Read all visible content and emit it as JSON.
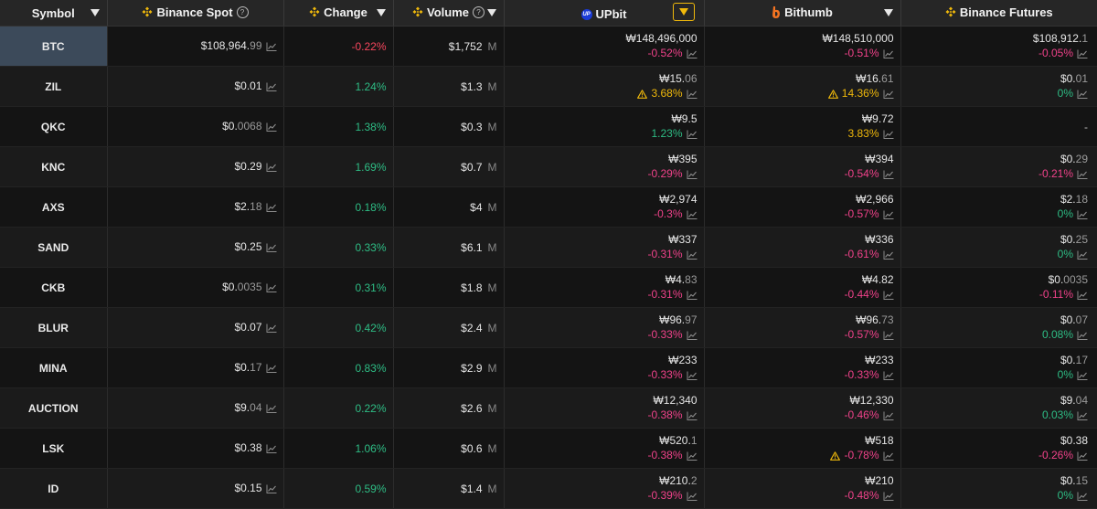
{
  "header": {
    "symbol": "Symbol",
    "binance_spot": "Binance Spot",
    "change": "Change",
    "volume": "Volume",
    "upbit": "UPbit",
    "bithumb": "Bithumb",
    "binance_futures": "Binance Futures",
    "upbit_icon_text": "UP"
  },
  "colors": {
    "negative": "#f6465d",
    "positive": "#2ebd85",
    "warning": "#f0b90b",
    "active_row": "#3c4a5a"
  },
  "rows": [
    {
      "symbol": "BTC",
      "spot": "$108,964.",
      "spot_dim": "99",
      "change": "-0.22%",
      "change_sign": "neg",
      "volume": "$1,752",
      "up_price": "₩148,496,000",
      "up_dim": "",
      "up_pct": "-0.52%",
      "up_sign": "negp",
      "up_warn": false,
      "bit_price": "₩148,510,000",
      "bit_dim": "",
      "bit_pct": "-0.51%",
      "bit_sign": "negp",
      "bit_warn": false,
      "fut_price": "$108,912.",
      "fut_dim": "1",
      "fut_pct": "-0.05%",
      "fut_sign": "negp"
    },
    {
      "symbol": "ZIL",
      "spot": "$0.01",
      "spot_dim": "",
      "change": "1.24%",
      "change_sign": "pos",
      "volume": "$1.3",
      "up_price": "₩15.",
      "up_dim": "06",
      "up_pct": "3.68%",
      "up_sign": "warn",
      "up_warn": true,
      "bit_price": "₩16.",
      "bit_dim": "61",
      "bit_pct": "14.36%",
      "bit_sign": "warn",
      "bit_warn": true,
      "fut_price": "$0.",
      "fut_dim": "01",
      "fut_pct": "0%",
      "fut_sign": "pos"
    },
    {
      "symbol": "QKC",
      "spot": "$0.",
      "spot_dim": "0068",
      "change": "1.38%",
      "change_sign": "pos",
      "volume": "$0.3",
      "up_price": "₩9.5",
      "up_dim": "",
      "up_pct": "1.23%",
      "up_sign": "pos",
      "up_warn": false,
      "bit_price": "₩9.72",
      "bit_dim": "",
      "bit_pct": "3.83%",
      "bit_sign": "warn",
      "bit_warn": false,
      "fut_price": "",
      "fut_dim": "",
      "fut_pct": "",
      "fut_sign": "pos",
      "fut_dash": "-"
    },
    {
      "symbol": "KNC",
      "spot": "$0.29",
      "spot_dim": "",
      "change": "1.69%",
      "change_sign": "pos",
      "volume": "$0.7",
      "up_price": "₩395",
      "up_dim": "",
      "up_pct": "-0.29%",
      "up_sign": "negp",
      "up_warn": false,
      "bit_price": "₩394",
      "bit_dim": "",
      "bit_pct": "-0.54%",
      "bit_sign": "negp",
      "bit_warn": false,
      "fut_price": "$0.",
      "fut_dim": "29",
      "fut_pct": "-0.21%",
      "fut_sign": "negp"
    },
    {
      "symbol": "AXS",
      "spot": "$2.",
      "spot_dim": "18",
      "change": "0.18%",
      "change_sign": "pos",
      "volume": "$4",
      "up_price": "₩2,974",
      "up_dim": "",
      "up_pct": "-0.3%",
      "up_sign": "negp",
      "up_warn": false,
      "bit_price": "₩2,966",
      "bit_dim": "",
      "bit_pct": "-0.57%",
      "bit_sign": "negp",
      "bit_warn": false,
      "fut_price": "$2.",
      "fut_dim": "18",
      "fut_pct": "0%",
      "fut_sign": "pos"
    },
    {
      "symbol": "SAND",
      "spot": "$0.25",
      "spot_dim": "",
      "change": "0.33%",
      "change_sign": "pos",
      "volume": "$6.1",
      "up_price": "₩337",
      "up_dim": "",
      "up_pct": "-0.31%",
      "up_sign": "negp",
      "up_warn": false,
      "bit_price": "₩336",
      "bit_dim": "",
      "bit_pct": "-0.61%",
      "bit_sign": "negp",
      "bit_warn": false,
      "fut_price": "$0.",
      "fut_dim": "25",
      "fut_pct": "0%",
      "fut_sign": "pos"
    },
    {
      "symbol": "CKB",
      "spot": "$0.",
      "spot_dim": "0035",
      "change": "0.31%",
      "change_sign": "pos",
      "volume": "$1.8",
      "up_price": "₩4.",
      "up_dim": "83",
      "up_pct": "-0.31%",
      "up_sign": "negp",
      "up_warn": false,
      "bit_price": "₩4.82",
      "bit_dim": "",
      "bit_pct": "-0.44%",
      "bit_sign": "negp",
      "bit_warn": false,
      "fut_price": "$0.",
      "fut_dim": "0035",
      "fut_pct": "-0.11%",
      "fut_sign": "negp"
    },
    {
      "symbol": "BLUR",
      "spot": "$0.07",
      "spot_dim": "",
      "change": "0.42%",
      "change_sign": "pos",
      "volume": "$2.4",
      "up_price": "₩96.",
      "up_dim": "97",
      "up_pct": "-0.33%",
      "up_sign": "negp",
      "up_warn": false,
      "bit_price": "₩96.",
      "bit_dim": "73",
      "bit_pct": "-0.57%",
      "bit_sign": "negp",
      "bit_warn": false,
      "fut_price": "$0.",
      "fut_dim": "07",
      "fut_pct": "0.08%",
      "fut_sign": "pos"
    },
    {
      "symbol": "MINA",
      "spot": "$0.",
      "spot_dim": "17",
      "change": "0.83%",
      "change_sign": "pos",
      "volume": "$2.9",
      "up_price": "₩233",
      "up_dim": "",
      "up_pct": "-0.33%",
      "up_sign": "negp",
      "up_warn": false,
      "bit_price": "₩233",
      "bit_dim": "",
      "bit_pct": "-0.33%",
      "bit_sign": "negp",
      "bit_warn": false,
      "fut_price": "$0.",
      "fut_dim": "17",
      "fut_pct": "0%",
      "fut_sign": "pos"
    },
    {
      "symbol": "AUCTION",
      "spot": "$9.",
      "spot_dim": "04",
      "change": "0.22%",
      "change_sign": "pos",
      "volume": "$2.6",
      "up_price": "₩12,340",
      "up_dim": "",
      "up_pct": "-0.38%",
      "up_sign": "negp",
      "up_warn": false,
      "bit_price": "₩12,330",
      "bit_dim": "",
      "bit_pct": "-0.46%",
      "bit_sign": "negp",
      "bit_warn": false,
      "fut_price": "$9.",
      "fut_dim": "04",
      "fut_pct": "0.03%",
      "fut_sign": "pos"
    },
    {
      "symbol": "LSK",
      "spot": "$0.38",
      "spot_dim": "",
      "change": "1.06%",
      "change_sign": "pos",
      "volume": "$0.6",
      "up_price": "₩520.",
      "up_dim": "1",
      "up_pct": "-0.38%",
      "up_sign": "negp",
      "up_warn": false,
      "bit_price": "₩518",
      "bit_dim": "",
      "bit_pct": "-0.78%",
      "bit_sign": "negp",
      "bit_warn": true,
      "fut_price": "$0.38",
      "fut_dim": "",
      "fut_pct": "-0.26%",
      "fut_sign": "negp"
    },
    {
      "symbol": "ID",
      "spot": "$0.15",
      "spot_dim": "",
      "change": "0.59%",
      "change_sign": "pos",
      "volume": "$1.4",
      "up_price": "₩210.",
      "up_dim": "2",
      "up_pct": "-0.39%",
      "up_sign": "negp",
      "up_warn": false,
      "bit_price": "₩210",
      "bit_dim": "",
      "bit_pct": "-0.48%",
      "bit_sign": "negp",
      "bit_warn": false,
      "fut_price": "$0.",
      "fut_dim": "15",
      "fut_pct": "0%",
      "fut_sign": "pos"
    }
  ],
  "volume_unit": "M",
  "icons": {
    "chart": "chart-line-icon",
    "warning": "warning-triangle-icon",
    "help": "help-circle-icon",
    "binance": "binance-logo-icon",
    "upbit": "upbit-logo-icon",
    "bithumb": "bithumb-logo-icon"
  }
}
